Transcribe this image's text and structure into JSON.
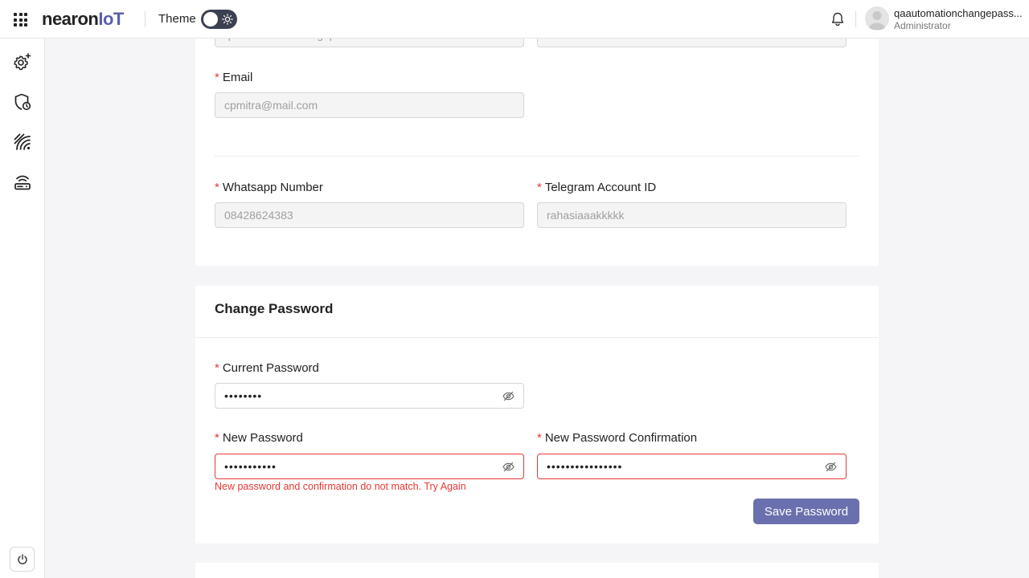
{
  "header": {
    "logo_brand": "nearon",
    "logo_suffix": "IoT",
    "theme_label": "Theme",
    "user_name": "qaautomationchangepass...",
    "user_role": "Administrator"
  },
  "profile": {
    "top_field_left_value": "qaautomationchangepasswordmitra",
    "top_field_right_value": "automationCPMITRA",
    "email_label": "Email",
    "email_value": "cpmitra@mail.com",
    "whatsapp_label": "Whatsapp Number",
    "whatsapp_value": "08428624383",
    "telegram_label": "Telegram Account ID",
    "telegram_value": "rahasiaaakkkkk"
  },
  "change_password": {
    "title": "Change Password",
    "current_label": "Current Password",
    "current_value": "••••••••",
    "new_label": "New Password",
    "new_value": "•••••••••••",
    "confirm_label": "New Password Confirmation",
    "confirm_value": "••••••••••••••••",
    "error_message": "New password and confirmation do not match. Try Again",
    "save_label": "Save Password"
  },
  "required_marker": "*",
  "colors": {
    "accent": "#6a6fad",
    "error": "#e53935",
    "brand_iot": "#5b5fae"
  },
  "icons": {
    "sidebar": [
      "settings-gear-icon",
      "shield-clock-icon",
      "signal-waves-icon",
      "router-wifi-icon"
    ],
    "sidebar_bottom": "power-icon",
    "header": [
      "apps-grid-icon",
      "sun-icon",
      "bell-icon",
      "user-avatar-icon"
    ],
    "password_toggle": "eye-off-icon"
  }
}
